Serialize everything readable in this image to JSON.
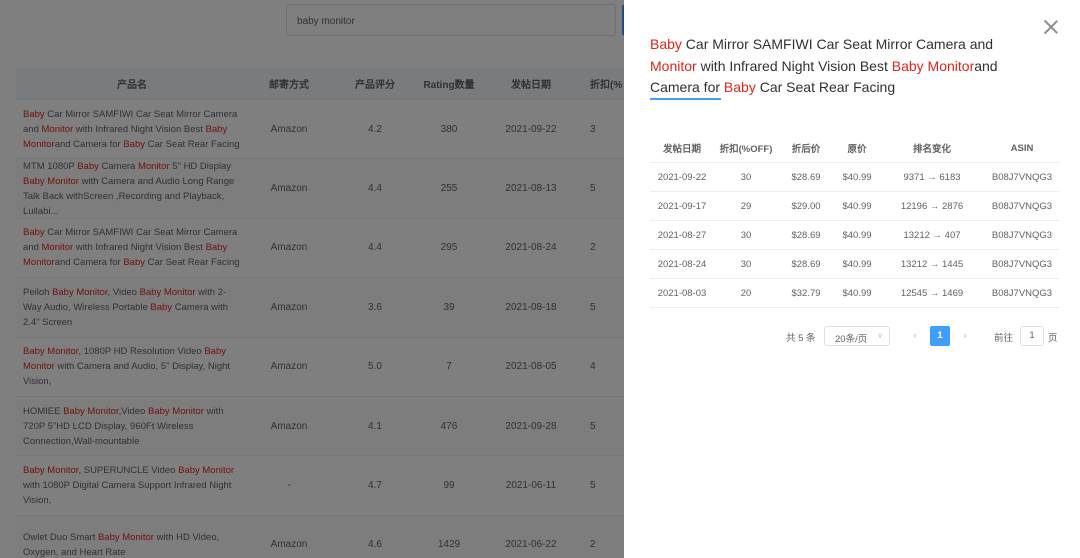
{
  "search": {
    "value": "baby monitor"
  },
  "main_table": {
    "headers": [
      "产品名",
      "邮寄方式",
      "产品评分",
      "Rating数量",
      "发帖日期",
      "折扣(%"
    ],
    "rows": [
      {
        "name_parts": [
          [
            "Baby",
            true
          ],
          [
            " Car Mirror SAMFIWI Car Seat Mirror Camera and ",
            false
          ],
          [
            "Monitor",
            true
          ],
          [
            " with Infrared Night Vision Best ",
            false
          ],
          [
            "Baby Monitor",
            true
          ],
          [
            "and Camera for ",
            false
          ],
          [
            "Baby",
            true
          ],
          [
            " Car Seat Rear Facing",
            false
          ]
        ],
        "shipping": "Amazon",
        "score": "4.2",
        "ratings": "380",
        "date": "2021-09-22",
        "discount": "3"
      },
      {
        "name_parts": [
          [
            "MTM 1080P ",
            false
          ],
          [
            "Baby",
            true
          ],
          [
            " Camera ",
            false
          ],
          [
            "Monitor",
            true
          ],
          [
            " 5\" HD Display ",
            false
          ],
          [
            "Baby Monitor",
            true
          ],
          [
            " with Camera and Audio Long Range Talk Back withScreen ,Recording and Playback, Lullabi...",
            false
          ]
        ],
        "shipping": "Amazon",
        "score": "4.4",
        "ratings": "255",
        "date": "2021-08-13",
        "discount": "5"
      },
      {
        "name_parts": [
          [
            "Baby",
            true
          ],
          [
            " Car Mirror SAMFIWI Car Seat Mirror Camera and ",
            false
          ],
          [
            "Monitor",
            true
          ],
          [
            " with Infrared Night Vision Best ",
            false
          ],
          [
            "Baby Monitor",
            true
          ],
          [
            "and Camera for ",
            false
          ],
          [
            "Baby",
            true
          ],
          [
            " Car Seat Rear Facing",
            false
          ]
        ],
        "shipping": "Amazon",
        "score": "4.4",
        "ratings": "295",
        "date": "2021-08-24",
        "discount": "2"
      },
      {
        "name_parts": [
          [
            "Peiloh ",
            false
          ],
          [
            "Baby Monitor",
            true
          ],
          [
            ", Video ",
            false
          ],
          [
            "Baby Monitor",
            true
          ],
          [
            " with 2-Way Audio, Wireless Portable ",
            false
          ],
          [
            "Baby",
            true
          ],
          [
            " Camera with 2.4\" Screen",
            false
          ]
        ],
        "shipping": "Amazon",
        "score": "3.6",
        "ratings": "39",
        "date": "2021-08-18",
        "discount": "5"
      },
      {
        "name_parts": [
          [
            "Baby Monitor",
            true
          ],
          [
            ", 1080P HD Resolution Video ",
            false
          ],
          [
            "Baby Monitor",
            true
          ],
          [
            " with Camera and Audio, 5\" Display, Night Vision,",
            false
          ]
        ],
        "shipping": "Amazon",
        "score": "5.0",
        "ratings": "7",
        "date": "2021-08-05",
        "discount": "4"
      },
      {
        "name_parts": [
          [
            "HOMIEE ",
            false
          ],
          [
            "Baby Monitor",
            true
          ],
          [
            ",Video ",
            false
          ],
          [
            "Baby Monitor",
            true
          ],
          [
            " with 720P 5\"HD LCD Display, 960Ft Wireless Connection,Wall-mountable",
            false
          ]
        ],
        "shipping": "Amazon",
        "score": "4.1",
        "ratings": "476",
        "date": "2021-09-28",
        "discount": "5"
      },
      {
        "name_parts": [
          [
            "Baby Monitor",
            true
          ],
          [
            ", SUPERUNCLE Video ",
            false
          ],
          [
            "Baby Monitor",
            true
          ],
          [
            " with 1080P Digital Camera Support Infrared Night Vision,",
            false
          ]
        ],
        "shipping": "-",
        "score": "4.7",
        "ratings": "99",
        "date": "2021-06-11",
        "discount": "5"
      },
      {
        "name_parts": [
          [
            "Owlet Duo Smart ",
            false
          ],
          [
            "Baby Monitor",
            true
          ],
          [
            " with HD Video, Oxygen, and Heart Rate",
            false
          ]
        ],
        "shipping": "Amazon",
        "score": "4.6",
        "ratings": "1429",
        "date": "2021-06-22",
        "discount": "2"
      }
    ]
  },
  "drawer": {
    "title_parts": [
      [
        "Baby",
        true
      ],
      [
        " Car Mirror SAMFIWI Car Seat Mirror Camera and ",
        false
      ],
      [
        "Monitor",
        true
      ],
      [
        " with Infrared Night Vision Best ",
        false
      ],
      [
        "Baby Monitor",
        true
      ],
      [
        "and Camera for ",
        false
      ],
      [
        "Baby",
        true
      ],
      [
        " Car Seat Rear Facing",
        false
      ]
    ],
    "headers": [
      "发帖日期",
      "折扣(%OFF)",
      "折后价",
      "原价",
      "排名变化",
      "ASIN"
    ],
    "rows": [
      [
        "2021-09-22",
        "30",
        "$28.69",
        "$40.99",
        "9371 → 6183",
        "B08J7VNQG3"
      ],
      [
        "2021-09-17",
        "29",
        "$29.00",
        "$40.99",
        "12196 → 2876",
        "B08J7VNQG3"
      ],
      [
        "2021-08-27",
        "30",
        "$28.69",
        "$40.99",
        "13212 → 407",
        "B08J7VNQG3"
      ],
      [
        "2021-08-24",
        "30",
        "$28.69",
        "$40.99",
        "13212 → 1445",
        "B08J7VNQG3"
      ],
      [
        "2021-08-03",
        "20",
        "$32.79",
        "$40.99",
        "12545 → 1469",
        "B08J7VNQG3"
      ]
    ],
    "pagination": {
      "total": "共 5 条",
      "page_size": "20条/页",
      "prev": "‹",
      "current": "1",
      "next": "›",
      "goto_label": "前往",
      "goto_value": "1",
      "page_suffix": "页"
    }
  },
  "colors": {
    "highlight": "#e0251b",
    "accent": "#409eff"
  }
}
